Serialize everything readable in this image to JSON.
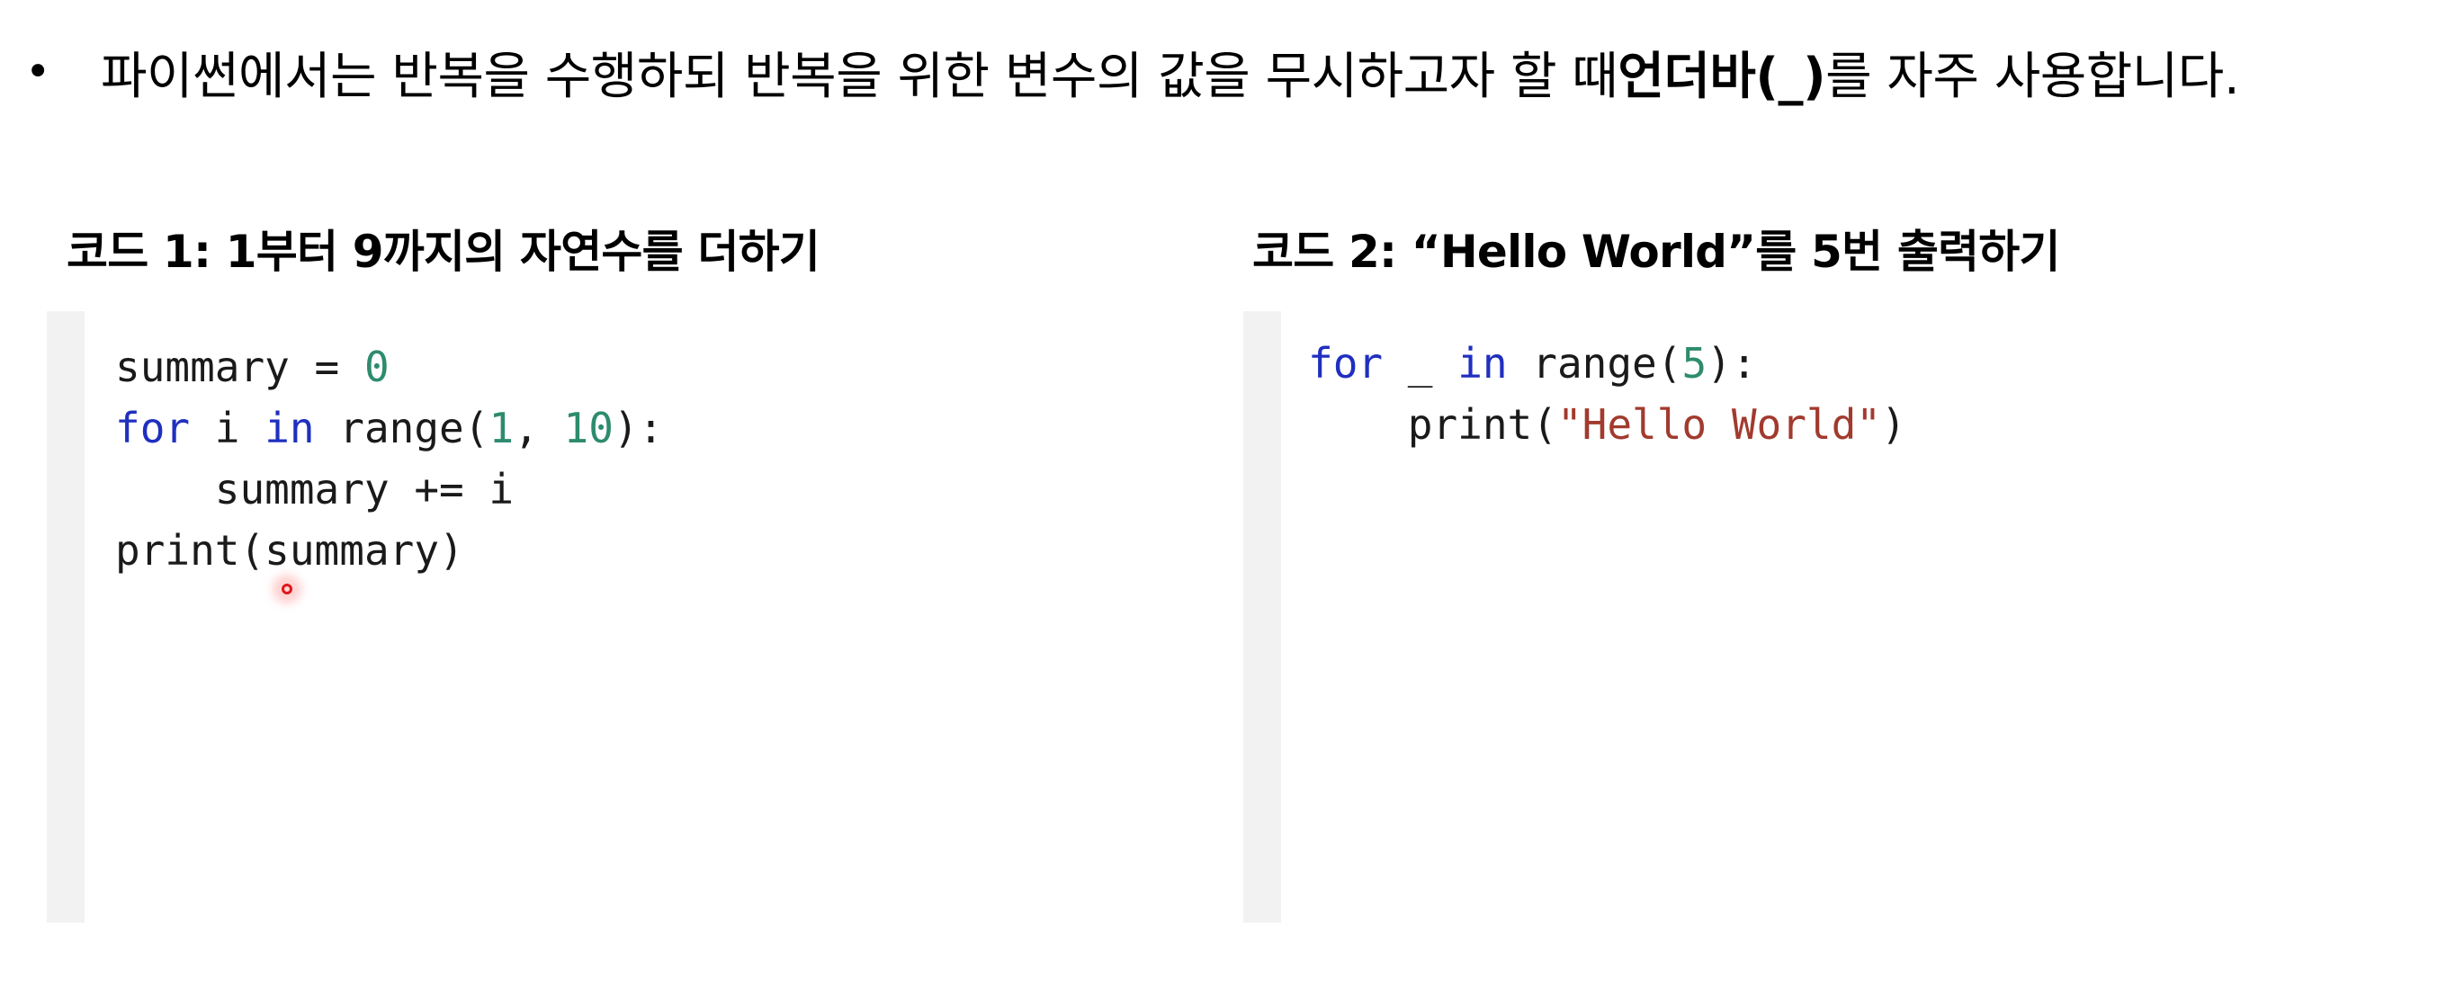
{
  "bullet": {
    "dot": "•",
    "text_before": "파이썬에서는 반복을 수행하되 반복을 위한 변수의 값을 무시하고자 할 때 ",
    "bold_term": "언더바(_)",
    "text_after": "를 자주 사용합니다."
  },
  "code1": {
    "title": "코드 1: 1부터 9까지의 자연수를 더하기",
    "lines": [
      [
        {
          "t": "summary = ",
          "c": "plain"
        },
        {
          "t": "0",
          "c": "num"
        }
      ],
      [
        {
          "t": "for",
          "c": "kw"
        },
        {
          "t": " i ",
          "c": "plain"
        },
        {
          "t": "in",
          "c": "kw"
        },
        {
          "t": " range(",
          "c": "plain"
        },
        {
          "t": "1",
          "c": "num"
        },
        {
          "t": ", ",
          "c": "plain"
        },
        {
          "t": "10",
          "c": "num"
        },
        {
          "t": "):",
          "c": "plain"
        }
      ],
      [
        {
          "t": "    summary += i",
          "c": "plain"
        }
      ],
      [
        {
          "t": "print(summary)",
          "c": "plain"
        }
      ]
    ]
  },
  "code2": {
    "title": "코드 2: “Hello World”를 5번 출력하기",
    "lines": [
      [
        {
          "t": "for",
          "c": "kw"
        },
        {
          "t": " _ ",
          "c": "plain"
        },
        {
          "t": "in",
          "c": "kw"
        },
        {
          "t": " range(",
          "c": "plain"
        },
        {
          "t": "5",
          "c": "num"
        },
        {
          "t": "):",
          "c": "plain"
        }
      ],
      [
        {
          "t": "    print(",
          "c": "plain"
        },
        {
          "t": "\"Hello World\"",
          "c": "str"
        },
        {
          "t": ")",
          "c": "plain"
        }
      ]
    ]
  },
  "colors": {
    "keyword": "#1f2fbf",
    "number": "#2e8b6e",
    "string": "#a23a2e",
    "gutter": "#f2f2f2",
    "cursor": "#e01818"
  }
}
